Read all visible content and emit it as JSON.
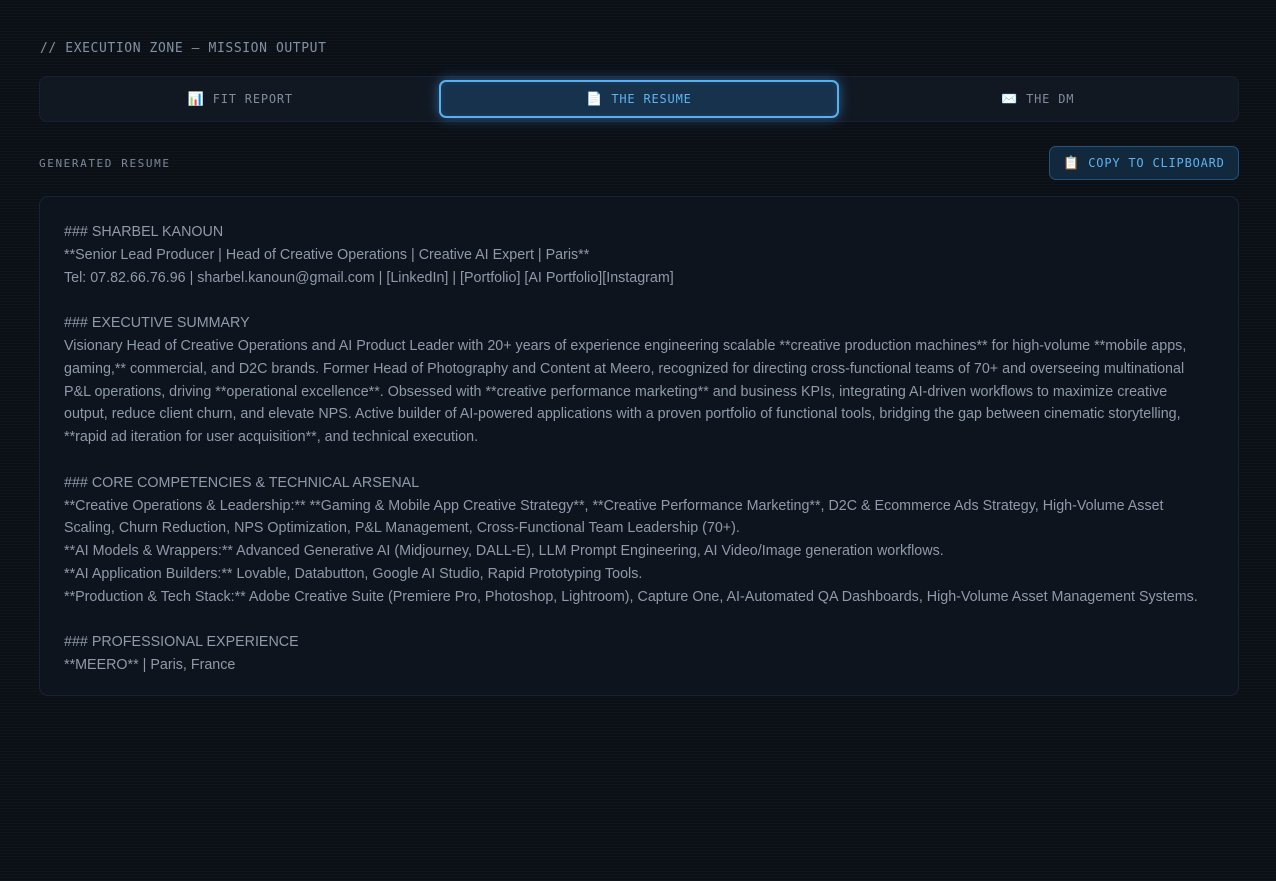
{
  "header": {
    "zone_title": "// EXECUTION ZONE — MISSION OUTPUT"
  },
  "tabs": [
    {
      "icon": "bar-chart-icon",
      "glyph": "📊",
      "label": "FIT REPORT",
      "active": false
    },
    {
      "icon": "document-icon",
      "glyph": "📄",
      "label": "THE RESUME",
      "active": true
    },
    {
      "icon": "envelope-icon",
      "glyph": "✉️",
      "label": "THE DM",
      "active": false
    }
  ],
  "section": {
    "label": "GENERATED RESUME",
    "copy_button_label": "COPY TO CLIPBOARD",
    "copy_button_icon": "clipboard-icon",
    "copy_button_glyph": "📋"
  },
  "resume": {
    "text": "### SHARBEL KANOUN\n**Senior Lead Producer | Head of Creative Operations | Creative AI Expert | Paris**\nTel: 07.82.66.76.96 | sharbel.kanoun@gmail.com | [LinkedIn] | [Portfolio] [AI Portfolio][Instagram]\n\n### EXECUTIVE SUMMARY\nVisionary Head of Creative Operations and AI Product Leader with 20+ years of experience engineering scalable **creative production machines** for high-volume **mobile apps, gaming,** commercial, and D2C brands. Former Head of Photography and Content at Meero, recognized for directing cross-functional teams of 70+ and overseeing multinational P&L operations, driving **operational excellence**. Obsessed with **creative performance marketing** and business KPIs, integrating AI-driven workflows to maximize creative output, reduce client churn, and elevate NPS. Active builder of AI-powered applications with a proven portfolio of functional tools, bridging the gap between cinematic storytelling, **rapid ad iteration for user acquisition**, and technical execution.\n\n### CORE COMPETENCIES & TECHNICAL ARSENAL\n**Creative Operations & Leadership:** **Gaming & Mobile App Creative Strategy**, **Creative Performance Marketing**, D2C & Ecommerce Ads Strategy, High-Volume Asset Scaling, Churn Reduction, NPS Optimization, P&L Management, Cross-Functional Team Leadership (70+).\n**AI Models & Wrappers:** Advanced Generative AI (Midjourney, DALL-E), LLM Prompt Engineering, AI Video/Image generation workflows.\n**AI Application Builders:** Lovable, Databutton, Google AI Studio, Rapid Prototyping Tools.\n**Production & Tech Stack:** Adobe Creative Suite (Premiere Pro, Photoshop, Lightroom), Capture One, AI-Automated QA Dashboards, High-Volume Asset Management Systems.\n\n### PROFESSIONAL EXPERIENCE\n**MEERO** | Paris, France"
  }
}
